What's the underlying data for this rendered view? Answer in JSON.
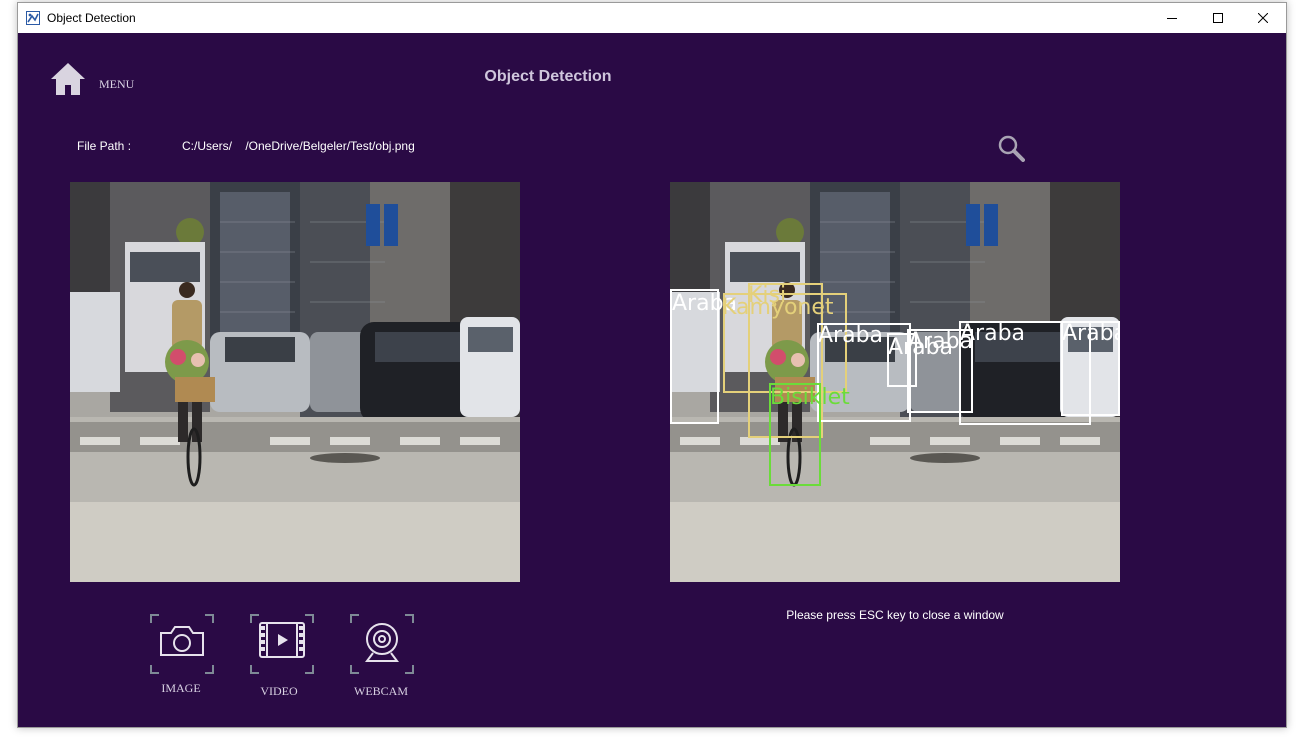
{
  "window": {
    "title": "Object Detection"
  },
  "header": {
    "menu_label": "MENU",
    "page_title": "Object Detection"
  },
  "file": {
    "label": "File Path :",
    "value": "C:/Users/    /OneDrive/Belgeler/Test/obj.png"
  },
  "detections": [
    {
      "label": "Araba"
    },
    {
      "label": "Kişi"
    },
    {
      "label": "Kamyonet"
    },
    {
      "label": "Araba"
    },
    {
      "label": "Araba"
    },
    {
      "label": "Araba"
    },
    {
      "label": "Araba"
    },
    {
      "label": "Araba"
    },
    {
      "label": "Bisiklet"
    }
  ],
  "hint": "Please press ESC key to close a window",
  "modes": {
    "image": "IMAGE",
    "video": "VIDEO",
    "webcam": "WEBCAM"
  },
  "colors": {
    "background": "#2a0a45",
    "box_white": "#ffffff",
    "box_yellow": "#e4d07a",
    "box_green": "#6bdc3a"
  }
}
